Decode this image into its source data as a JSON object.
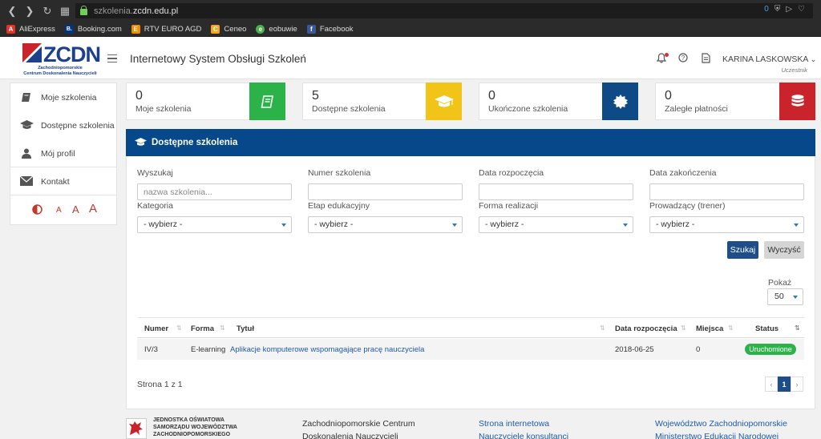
{
  "browser": {
    "url_prefix": "szkolenia.",
    "url_domain": "zcdn.edu.pl",
    "counter": "0",
    "bookmarks": [
      {
        "label": "AliExpress",
        "color": "#e43225",
        "glyph": "A"
      },
      {
        "label": "Booking.com",
        "color": "#003580",
        "glyph": "B."
      },
      {
        "label": "RTV EURO AGD",
        "color": "#f28c00",
        "glyph": "E"
      },
      {
        "label": "Ceneo",
        "color": "#f5a623",
        "glyph": "C"
      },
      {
        "label": "eobuwie",
        "color": "#4caf50",
        "glyph": "e"
      },
      {
        "label": "Facebook",
        "color": "#3b5998",
        "glyph": "f"
      }
    ]
  },
  "header": {
    "logo_text": "ZCDN",
    "logo_sub1": "Zachodniopomorskie",
    "logo_sub2": "Centrum Doskonalenia Nauczycieli",
    "app_title": "Internetowy System Obsługi Szkoleń",
    "user_name": "KARINA LASKOWSKA",
    "user_role": "Uczestnik",
    "icons": [
      "bell-icon",
      "help-icon",
      "document-icon"
    ]
  },
  "sidebar": {
    "items": [
      {
        "label": "Moje szkolenia",
        "icon": "book-icon"
      },
      {
        "label": "Dostępne szkolenia",
        "icon": "graduation-cap-icon"
      },
      {
        "label": "Mój profil",
        "icon": "user-icon"
      },
      {
        "label": "Kontakt",
        "icon": "envelope-icon"
      }
    ],
    "font_sizes": [
      "A",
      "A",
      "A"
    ]
  },
  "cards": [
    {
      "value": "0",
      "label": "Moje szkolenia",
      "color": "#2bb34a",
      "icon": "book-icon"
    },
    {
      "value": "5",
      "label": "Dostępne szkolenia",
      "color": "#f2c418",
      "icon": "graduation-cap-icon"
    },
    {
      "value": "0",
      "label": "Ukończone szkolenia",
      "color": "#0d4a86",
      "icon": "certificate-icon"
    },
    {
      "value": "0",
      "label": "Zaległe płatności",
      "color": "#c9242c",
      "icon": "database-icon"
    }
  ],
  "panel": {
    "title": "Dostępne szkolenia",
    "filters": {
      "search_label": "Wyszukaj",
      "search_placeholder": "nazwa szkolenia...",
      "number_label": "Numer szkolenia",
      "start_label": "Data rozpoczęcia",
      "end_label": "Data zakończenia",
      "category_label": "Kategoria",
      "category_value": "- wybierz -",
      "stage_label": "Etap edukacyjny",
      "stage_value": "- wybierz -",
      "form_label": "Forma realizacji",
      "form_value": "- wybierz -",
      "trainer_label": "Prowadzący (trener)",
      "trainer_value": "- wybierz -"
    },
    "search_button": "Szukaj",
    "clear_button": "Wyczyść",
    "page_size_label": "Pokaż",
    "page_size_value": "50",
    "table": {
      "columns": [
        "Numer",
        "Forma",
        "Tytuł",
        "Data rozpoczęcia",
        "Miejsca",
        "Status"
      ],
      "rows": [
        {
          "number": "IV/3",
          "form": "E-learning",
          "title": "Aplikacje komputerowe wspomagające pracę nauczyciela",
          "start": "2018-06-25",
          "places": "0",
          "status": "Uruchomione"
        }
      ]
    },
    "page_info": "Strona 1 z 1",
    "pager": {
      "prev": "‹",
      "current": "1",
      "next": "›"
    }
  },
  "footer": {
    "crest_lines": [
      "JEDNOSTKA OŚWIATOWA",
      "SAMORZĄDU WOJEWÓDZTWA",
      "ZACHODNIOPOMORSKIEGO"
    ],
    "org_lines": [
      "Zachodniopomorskie Centrum",
      "Doskonalenia Nauczycieli"
    ],
    "links_col1": [
      "Strona internetowa",
      "Nauczyciele konsultanci"
    ],
    "links_col2": [
      "Województwo Zachodniopomorskie",
      "Ministerstwo Edukacji Narodowej"
    ]
  }
}
